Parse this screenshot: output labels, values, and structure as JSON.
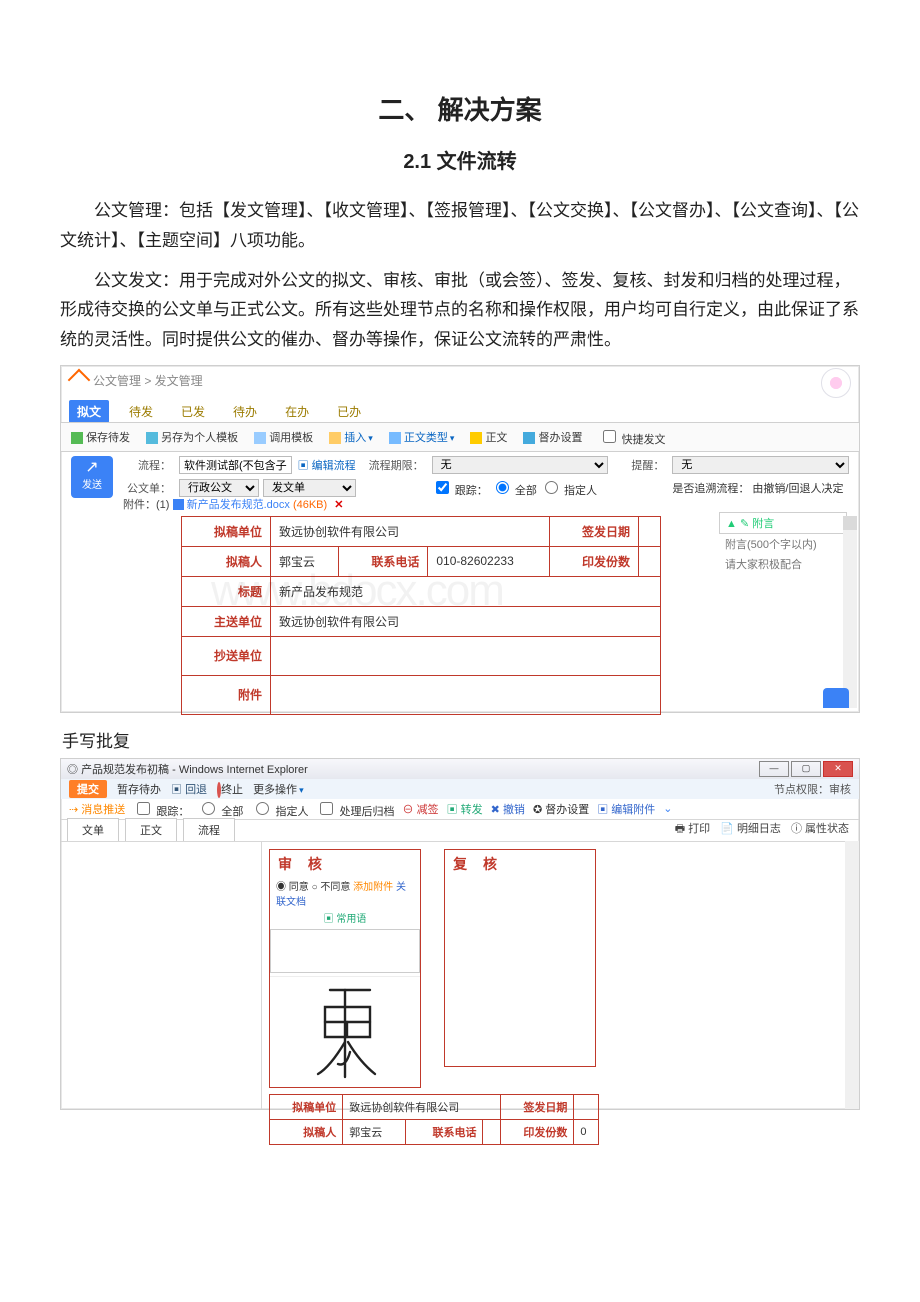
{
  "doc": {
    "title": "二、 解决方案",
    "subtitle": "2.1 文件流转",
    "para1": "公文管理：包括【发文管理】、【收文管理】、【签报管理】、【公文交换】、【公文督办】、【公文查询】、【公文统计】、【主题空间】八项功能。",
    "para2": "公文发文：用于完成对外公文的拟文、审核、审批（或会签）、签发、复核、封发和归档的处理过程，形成待交换的公文单与正式公文。所有这些处理节点的名称和操作权限，用户均可自行定义，由此保证了系统的灵活性。同时提供公文的催办、督办等操作，保证公文流转的严肃性。",
    "caption2": "手写批复"
  },
  "s1": {
    "crumb": "公文管理 > 发文管理",
    "tabs": {
      "t1": "拟文",
      "t2": "待发",
      "t3": "已发",
      "t4": "待办",
      "t5": "在办",
      "t6": "已办"
    },
    "tb": {
      "save": "保存待发",
      "saveTpl": "另存为个人模板",
      "callTpl": "调用模板",
      "insert": "插入",
      "bodyType": "正文类型",
      "body": "正文",
      "superv": "督办设置",
      "quick": "快捷发文"
    },
    "send": "发送",
    "lbl": {
      "flow": "流程：",
      "unit": "公文单：",
      "editFlow": "编辑流程",
      "period": "流程期限：",
      "track": "跟踪：",
      "all": "全部",
      "assign": "指定人",
      "remind": "提醒：",
      "redflow": "是否追溯流程：",
      "reddesc": "由撤销/回退人决定"
    },
    "val": {
      "flow": "软件测试部(不包含子部门)(审批)",
      "unitSel": "行政公文",
      "unitText": "发文单",
      "period": "无",
      "remind": "无"
    },
    "att": {
      "label": "附件：(1)",
      "file": "新产品发布规范.docx",
      "size": "(46KB)",
      "x": "✕"
    },
    "form": {
      "k_draftUnit": "拟稿单位",
      "v_draftUnit": "致远协创软件有限公司",
      "k_signDate": "签发日期",
      "v_signDate": "",
      "k_drafter": "拟稿人",
      "v_drafter": "郭宝云",
      "k_phone": "联系电话",
      "v_phone": "010-82602233",
      "k_copies": "印发份数",
      "v_copies": "",
      "k_title": "标题",
      "v_title": "新产品发布规范",
      "k_main": "主送单位",
      "v_main": "致远协创软件有限公司",
      "k_cc": "抄送单位",
      "v_cc": "",
      "k_att": "附件",
      "v_att": ""
    },
    "side": {
      "hdr": "附言",
      "sub1": "附言(500个字以内)",
      "sub2": "请大家积极配合"
    }
  },
  "s2": {
    "wtitle": "产品规范发布初稿 - Windows Internet Explorer",
    "bar2": {
      "submit": "提交",
      "save": "暂存待办",
      "back": "回退",
      "stop": "终止",
      "more": "更多操作",
      "right": "节点权限：审核"
    },
    "bar3": {
      "push": "消息推送",
      "track": "跟踪：",
      "all": "全部",
      "assign": "指定人",
      "archive": "处理后归档",
      "minus": "减签",
      "fwd": "转发",
      "repeal": "撤销",
      "superv": "督办设置",
      "att": "编辑附件"
    },
    "subtabs": {
      "t1": "文单",
      "t2": "正文",
      "t3": "流程",
      "rt_print": "打印",
      "rt_log": "明细日志",
      "rt_attr": "属性状态"
    },
    "sh": {
      "title": "审 核",
      "agree": "同意",
      "disagree": "不同意",
      "addatt": "添加附件",
      "relfile": "关联文档",
      "common": "常用语"
    },
    "fh": {
      "title": "复 核"
    },
    "ft": {
      "k_draftUnit": "拟稿单位",
      "v_draftUnit": "致远协创软件有限公司",
      "k_signDate": "签发日期",
      "v_signDate": "",
      "k_drafter": "拟稿人",
      "v_drafter": "郭宝云",
      "k_phone": "联系电话",
      "v_phone": "",
      "k_copies": "印发份数",
      "v_copies": "0"
    }
  }
}
